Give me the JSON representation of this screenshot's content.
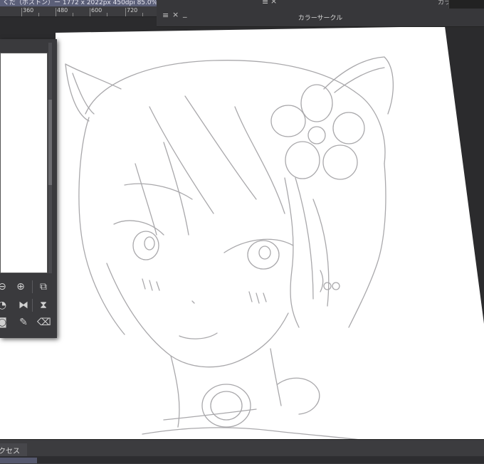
{
  "window": {
    "title": "くだ（ボストン）ー 1772 x 2022px 450dpi 85.0%)"
  },
  "ruler": {
    "labels": [
      "360",
      "480",
      "600",
      "720"
    ]
  },
  "color_circle_panel": {
    "title": "カラーサークル",
    "close_glyph": "×",
    "minimize_glyph": "_",
    "grip_glyph": "≡"
  },
  "color_history_panel": {
    "title": "カラーヒストリー",
    "close_glyph": "×"
  },
  "bottom": {
    "tab_label": "クセス"
  },
  "navigator": {
    "tools": [
      "zoom-out-icon",
      "zoom-in-icon",
      "fit-icon",
      "rotate-icon",
      "flip-horizontal-icon",
      "flip-vertical-icon",
      "camera-icon",
      "edit-icon",
      "trash-icon"
    ]
  },
  "colors": {
    "ui_dark": "#2b2b2d",
    "panel": "#3a3a3d",
    "title_strip": "#5b5f78",
    "sketch": "#a9a8ab",
    "paper": "#ffffff"
  }
}
